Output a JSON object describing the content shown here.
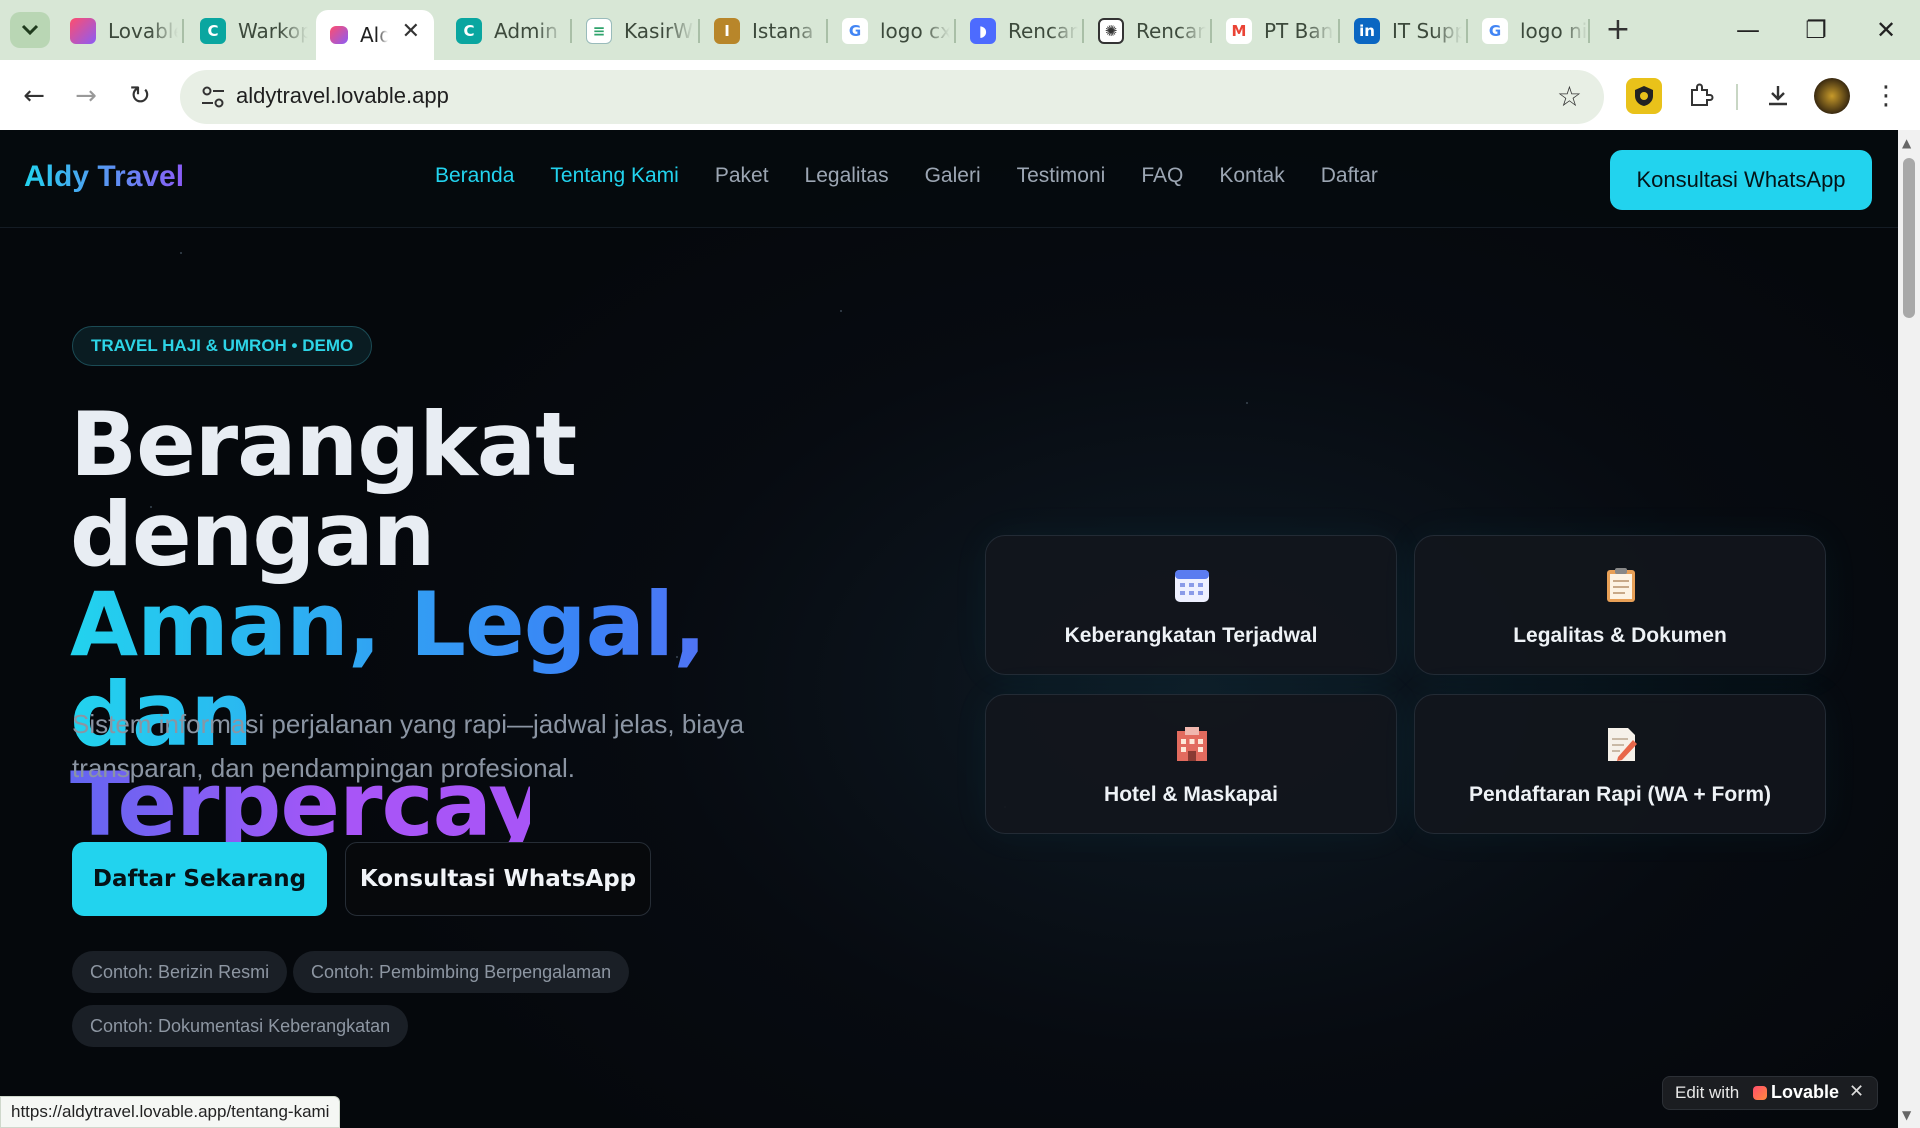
{
  "browser": {
    "tabs": [
      {
        "label": "Lovable",
        "favicon": "lovable-heart-icon",
        "color": "#ff5a6e"
      },
      {
        "label": "Warkop",
        "favicon": "codeium-icon",
        "color": "#0aa6a0"
      },
      {
        "label": "Aldy Travel",
        "favicon": "lovable-heart-icon",
        "color": "#ff5a6e",
        "active": true
      },
      {
        "label": "Admin",
        "favicon": "codeium-icon",
        "color": "#0aa6a0"
      },
      {
        "label": "KasirWarkop",
        "favicon": "document-icon",
        "color": "#2ea36b"
      },
      {
        "label": "Istana Pos",
        "favicon": "istana-logo-icon",
        "color": "#b8862a"
      },
      {
        "label": "logo cx",
        "favicon": "google-icon",
        "color": "#4285f4"
      },
      {
        "label": "Rencana",
        "favicon": "deepseek-icon",
        "color": "#4d6bfe"
      },
      {
        "label": "Rencana",
        "favicon": "chatgpt-icon",
        "color": "#333333"
      },
      {
        "label": "PT Bank",
        "favicon": "gmail-icon",
        "color": "#ea4335"
      },
      {
        "label": "IT Support",
        "favicon": "linkedin-icon",
        "color": "#0a66c2"
      },
      {
        "label": "logo ni",
        "favicon": "google-icon",
        "color": "#4285f4"
      }
    ],
    "url": "aldytravel.lovable.app",
    "status_url": "https://aldytravel.lovable.app/tentang-kami"
  },
  "site": {
    "brand": "Aldy Travel",
    "nav": [
      "Beranda",
      "Tentang Kami",
      "Paket",
      "Legalitas",
      "Galeri",
      "Testimoni",
      "FAQ",
      "Kontak",
      "Daftar"
    ],
    "cta": "Konsultasi WhatsApp",
    "badge": "TRAVEL HAJI & UMROH • DEMO",
    "hero": {
      "line1": "Berangkat dengan",
      "line2": "Aman, Legal, dan",
      "line3": "Terpercaya",
      "subtitle": "Sistem informasi perjalanan yang rapi—jadwal jelas, biaya transparan, dan pendampingan profesional."
    },
    "primary_button": "Daftar Sekarang",
    "secondary_button": "Konsultasi WhatsApp",
    "chips": [
      "Contoh: Berizin Resmi",
      "Contoh: Pembimbing Berpengalaman",
      "Contoh: Dokumentasi Keberangkatan"
    ],
    "features": [
      {
        "label": "Keberangkatan Terjadwal",
        "icon": "calendar-icon"
      },
      {
        "label": "Legalitas & Dokumen",
        "icon": "clipboard-icon"
      },
      {
        "label": "Hotel & Maskapai",
        "icon": "hotel-icon"
      },
      {
        "label": "Pendaftaran Rapi (WA + Form)",
        "icon": "memo-icon"
      }
    ]
  },
  "lovable_badge": {
    "text": "Edit with",
    "brand": "Lovable"
  },
  "colors": {
    "accent": "#22d3ee",
    "purple": "#a855f7",
    "background": "#05080c"
  }
}
